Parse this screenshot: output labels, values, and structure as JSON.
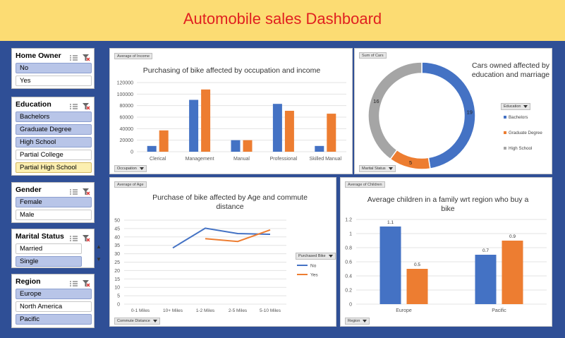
{
  "title": "Automobile sales Dashboard",
  "slicers": {
    "home_owner": {
      "title": "Home Owner",
      "items": [
        {
          "label": "No",
          "state": "sel"
        },
        {
          "label": "Yes",
          "state": "un"
        }
      ]
    },
    "education": {
      "title": "Education",
      "items": [
        {
          "label": "Bachelors",
          "state": "sel"
        },
        {
          "label": "Graduate Degree",
          "state": "sel"
        },
        {
          "label": "High School",
          "state": "sel"
        },
        {
          "label": "Partial College",
          "state": "un"
        },
        {
          "label": "Partial High School",
          "state": "hi"
        }
      ]
    },
    "gender": {
      "title": "Gender",
      "items": [
        {
          "label": "Female",
          "state": "sel"
        },
        {
          "label": "Male",
          "state": "un"
        }
      ]
    },
    "marital": {
      "title": "Marital Status",
      "items": [
        {
          "label": "Married",
          "state": "un"
        },
        {
          "label": "Single",
          "state": "sel"
        }
      ]
    },
    "region": {
      "title": "Region",
      "items": [
        {
          "label": "Europe",
          "state": "sel"
        },
        {
          "label": "North America",
          "state": "un"
        },
        {
          "label": "Pacific",
          "state": "sel"
        }
      ]
    }
  },
  "scroll": {
    "up": "▲",
    "down": "▼"
  },
  "colors": {
    "blue": "#4472c4",
    "orange": "#ed7d31",
    "gray": "#a5a5a5"
  },
  "chart_data": [
    {
      "type": "bar",
      "title": "Purchasing of bike affected by occupation and income",
      "field_button": "Average of Income",
      "axis_button": "Occupation",
      "categories": [
        "Clerical",
        "Management",
        "Manual",
        "Professional",
        "Skilled Manual"
      ],
      "series": [
        {
          "values": [
            10000,
            90000,
            20000,
            83000,
            10000
          ]
        },
        {
          "values": [
            37000,
            108000,
            20000,
            71000,
            66000
          ]
        }
      ],
      "ylim": [
        0,
        120000
      ],
      "yticks": [
        "0",
        "20000",
        "40000",
        "60000",
        "80000",
        "100000",
        "120000"
      ],
      "grid": true
    },
    {
      "type": "pie",
      "title": "Cars owned affected by education and marriage",
      "field_button": "Sum of Cars",
      "axis_button": "Marital Status",
      "legend_title": "Education",
      "labels": [
        "Bachelors",
        "Graduate Degree",
        "High School"
      ],
      "values": [
        19,
        5,
        16
      ],
      "value_labels": [
        "19",
        "5",
        "16"
      ],
      "legend": "right"
    },
    {
      "type": "line",
      "title": "Purchase of bike affected by Age and commute distance",
      "field_button": "Average of Age",
      "axis_button": "Commute Distance",
      "legend_title": "Purchased Bike",
      "x": [
        "0-1 Miles",
        "10+ Miles",
        "1-2 Miles",
        "2-5 Miles",
        "5-10 Miles"
      ],
      "series": [
        {
          "name": "No",
          "values": [
            null,
            33.5,
            45.2,
            42,
            41.6
          ]
        },
        {
          "name": "Yes",
          "values": [
            null,
            null,
            39,
            37.3,
            44.2
          ]
        }
      ],
      "ylim": [
        0,
        50
      ],
      "yticks": [
        "0",
        "5",
        "10",
        "15",
        "20",
        "25",
        "30",
        "35",
        "40",
        "45",
        "50"
      ],
      "legend": "right",
      "grid": true
    },
    {
      "type": "bar",
      "title": "Average children in a family wrt region who buy a bike",
      "field_button": "Average of Children",
      "axis_button": "Region",
      "categories": [
        "Europe",
        "Pacific"
      ],
      "series": [
        {
          "values": [
            1.1,
            0.7
          ],
          "value_labels": [
            "1.1",
            "0.7"
          ]
        },
        {
          "values": [
            0.5,
            0.9
          ],
          "value_labels": [
            "0.5",
            "0.9"
          ]
        }
      ],
      "ylim": [
        0,
        1.2
      ],
      "yticks": [
        "0",
        "0.2",
        "0.4",
        "0.6",
        "0.8",
        "1",
        "1.2"
      ],
      "grid": true
    }
  ]
}
